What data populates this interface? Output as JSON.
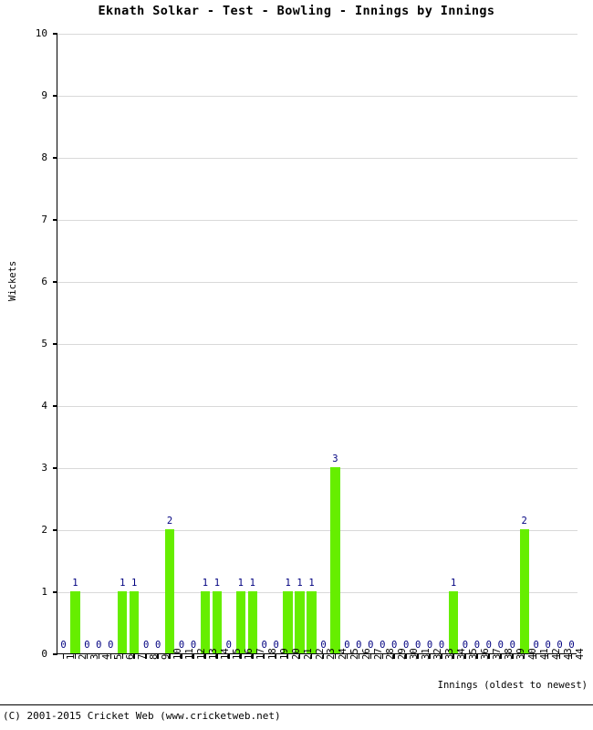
{
  "chart_data": {
    "type": "bar",
    "title": "Eknath Solkar - Test - Bowling - Innings by Innings",
    "xlabel": "Innings (oldest to newest)",
    "ylabel": "Wickets",
    "ylim": [
      0,
      10
    ],
    "yticks": [
      0,
      1,
      2,
      3,
      4,
      5,
      6,
      7,
      8,
      9,
      10
    ],
    "grid": true,
    "legend": "none",
    "bar_color": "#66ee00",
    "value_label_color": "#000080",
    "categories": [
      1,
      2,
      3,
      4,
      5,
      6,
      7,
      8,
      9,
      10,
      11,
      12,
      13,
      14,
      15,
      16,
      17,
      18,
      19,
      20,
      21,
      22,
      23,
      24,
      25,
      26,
      27,
      28,
      29,
      30,
      31,
      32,
      33,
      34,
      35,
      36,
      37,
      38,
      39,
      40,
      41,
      42,
      43,
      44
    ],
    "values": [
      0,
      1,
      0,
      0,
      0,
      1,
      1,
      0,
      0,
      2,
      0,
      0,
      1,
      1,
      0,
      1,
      1,
      0,
      0,
      1,
      1,
      1,
      0,
      3,
      0,
      0,
      0,
      0,
      0,
      0,
      0,
      0,
      0,
      1,
      0,
      0,
      0,
      0,
      0,
      2,
      0,
      0,
      0,
      0
    ],
    "series": [
      {
        "name": "Wickets",
        "values": [
          0,
          1,
          0,
          0,
          0,
          1,
          1,
          0,
          0,
          2,
          0,
          0,
          1,
          1,
          0,
          1,
          1,
          0,
          0,
          1,
          1,
          1,
          0,
          3,
          0,
          0,
          0,
          0,
          0,
          0,
          0,
          0,
          0,
          1,
          0,
          0,
          0,
          0,
          0,
          2,
          0,
          0,
          0,
          0
        ]
      }
    ]
  },
  "footer": {
    "copyright": "(C) 2001-2015 Cricket Web (www.cricketweb.net)"
  }
}
